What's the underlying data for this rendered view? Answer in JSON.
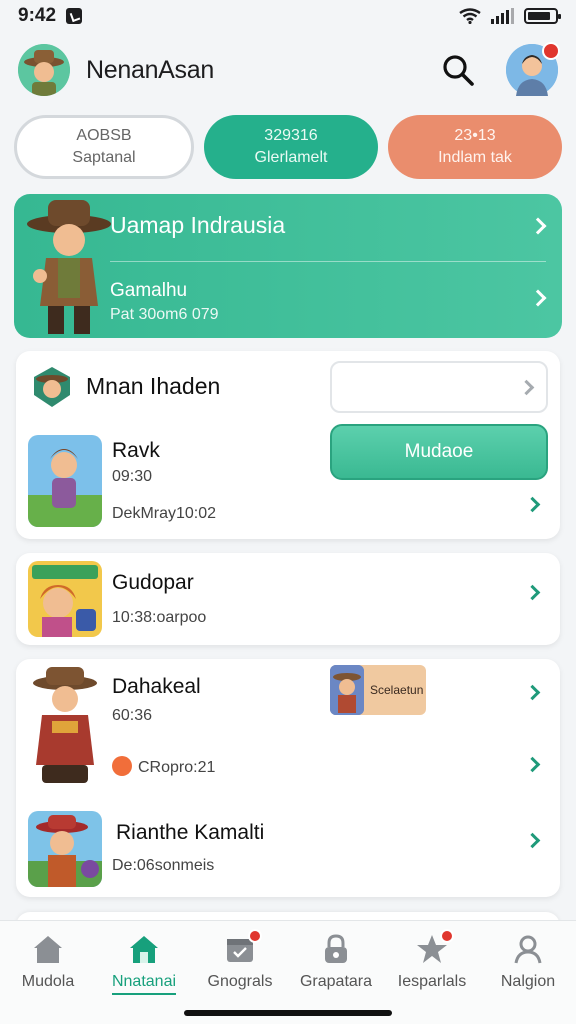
{
  "status": {
    "time": "9:42",
    "battery_level": 0.85
  },
  "header": {
    "title": "NenanAsan",
    "avatar_icon": "explorer-avatar-icon",
    "search_icon": "search-icon",
    "profile_icon": "profile-avatar-icon"
  },
  "pills": [
    {
      "top": "AOBSB",
      "bottom": "Saptanal",
      "style": "outline"
    },
    {
      "top": "329316",
      "bottom": "Glerlamelt",
      "style": "green"
    },
    {
      "top": "23•13",
      "bottom": "Indlam tak",
      "style": "orange"
    }
  ],
  "hero": {
    "title": "Uamap Indrausia",
    "subtitle": "Gamalhu",
    "meta": "Pat 30om6 079"
  },
  "cards": {
    "first": {
      "header_title": "Mnan Ihaden",
      "item_name": "Ravk",
      "item_time": "09:30",
      "item_meta": "DekMray10:02",
      "button_label": "Mudaoe"
    },
    "second": {
      "name": "Gudopar",
      "meta": "10:38:oarpoo"
    },
    "third": {
      "item1_name": "Dahakeal",
      "item1_time": "60:36",
      "item1_meta": "CRopro:21",
      "badge_label": "Scelaetun",
      "item2_name": "Rianthe Kamalti",
      "item2_meta": "De:06sonmeis"
    }
  },
  "tabs": [
    {
      "label": "Mudola",
      "icon": "home-icon",
      "active": false
    },
    {
      "label": "Nnatanai",
      "icon": "home-icon",
      "active": true
    },
    {
      "label": "Gnograls",
      "icon": "calendar-icon",
      "active": false
    },
    {
      "label": "Grapatara",
      "icon": "lock-icon",
      "active": false
    },
    {
      "label": "Iesparlals",
      "icon": "star-icon",
      "active": false
    },
    {
      "label": "Nalgion",
      "icon": "person-icon",
      "active": false
    }
  ],
  "colors": {
    "accent": "#25b08c",
    "orange": "#ea8d6d",
    "badge": "#e0362e"
  }
}
